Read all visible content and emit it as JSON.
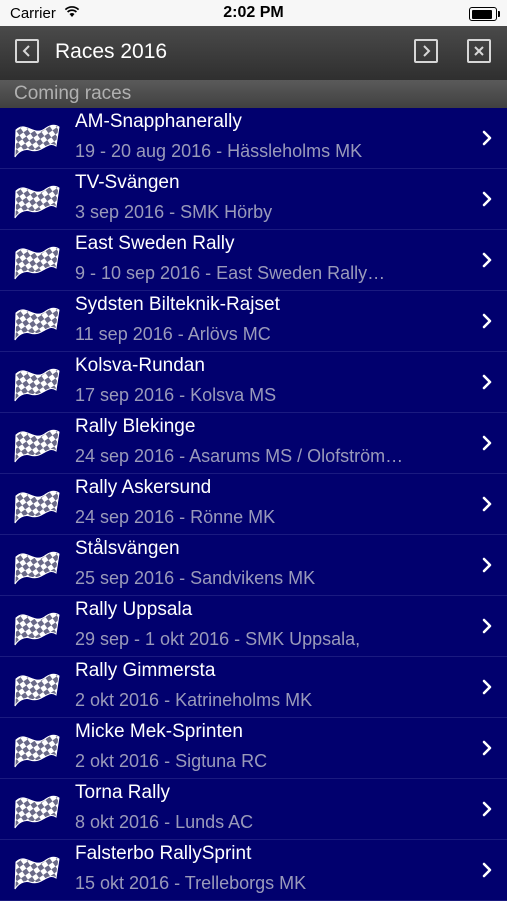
{
  "status": {
    "carrier": "Carrier",
    "time": "2:02 PM"
  },
  "nav": {
    "title": "Races 2016"
  },
  "section": {
    "title": "Coming races"
  },
  "races": [
    {
      "name": "AM-Snapphanerally",
      "detail": "19 - 20 aug 2016 - Hässleholms MK"
    },
    {
      "name": "TV-Svängen",
      "detail": "3 sep 2016 - SMK Hörby"
    },
    {
      "name": "East Sweden Rally",
      "detail": "9 - 10 sep 2016 - East Sweden Rally…"
    },
    {
      "name": "Sydsten Bilteknik-Rajset",
      "detail": "11 sep 2016 - Arlövs MC"
    },
    {
      "name": "Kolsva-Rundan",
      "detail": "17 sep 2016 - Kolsva MS"
    },
    {
      "name": "Rally Blekinge",
      "detail": "24 sep 2016 - Asarums MS / Olofström…"
    },
    {
      "name": "Rally Askersund",
      "detail": "24 sep 2016 - Rönne MK"
    },
    {
      "name": "Stålsvängen",
      "detail": "25 sep 2016 - Sandvikens MK"
    },
    {
      "name": "Rally Uppsala",
      "detail": " 29 sep - 1 okt 2016 - SMK Uppsala,"
    },
    {
      "name": "Rally Gimmersta",
      "detail": "2 okt 2016 - Katrineholms MK"
    },
    {
      "name": "Micke Mek-Sprinten",
      "detail": "2 okt 2016 - Sigtuna RC"
    },
    {
      "name": "Torna Rally",
      "detail": "8 okt 2016 - Lunds AC"
    },
    {
      "name": "Falsterbo RallySprint",
      "detail": "15 okt 2016 - Trelleborgs MK"
    }
  ],
  "icons": {
    "race": "checkered-flag-icon",
    "disclosure": "chevron-right-icon",
    "back": "chevron-left-icon",
    "forward": "chevron-right-icon",
    "close": "close-icon"
  },
  "colors": {
    "background": "#01006e",
    "nav": "#3a3a3a",
    "text": "#ffffff",
    "detail": "#9a9aba"
  }
}
